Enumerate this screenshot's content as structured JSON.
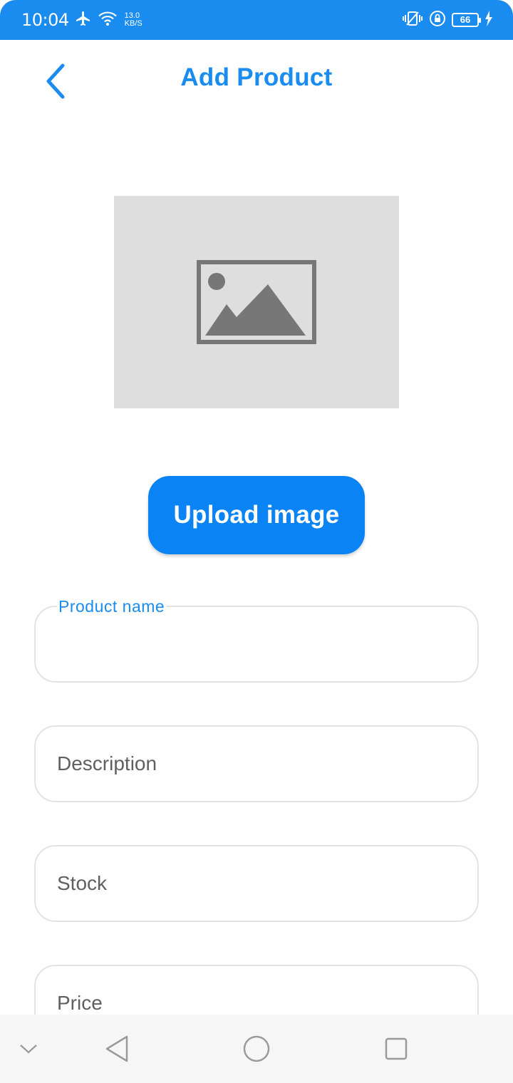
{
  "status_bar": {
    "time": "10:04",
    "speed_value": "13.0",
    "speed_unit": "KB/S",
    "battery": "66",
    "icons": [
      "airplane-icon",
      "wifi-icon",
      "vibrate-icon",
      "lock-rotation-icon",
      "battery-icon",
      "charging-icon"
    ]
  },
  "header": {
    "title": "Add Product",
    "back_icon": "chevron-left-icon"
  },
  "image_preview": {
    "icon": "image-placeholder-icon"
  },
  "upload_button": {
    "label": "Upload image"
  },
  "form": {
    "product_name": {
      "label": "Product name",
      "value": ""
    },
    "description": {
      "label": "Description",
      "value": ""
    },
    "stock": {
      "label": "Stock",
      "value": ""
    },
    "price": {
      "label": "Price",
      "value": ""
    }
  },
  "nav_bar": {
    "icons": [
      "chevron-down-icon",
      "back-triangle-icon",
      "home-circle-icon",
      "recents-square-icon"
    ]
  },
  "colors": {
    "primary": "#1a8cf0",
    "button": "#0a84f5",
    "placeholder_bg": "#dedede",
    "field_border": "#e3e3e3"
  }
}
